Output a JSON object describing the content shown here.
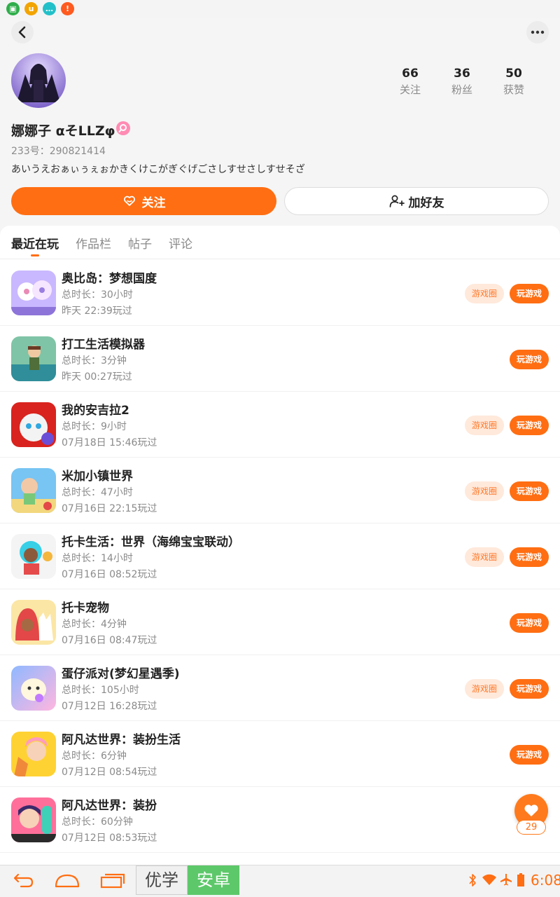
{
  "profile": {
    "name": "娜娜子 αそLLZφ",
    "id_line": "233号：290821414",
    "bio": "あいうえおぁぃぅぇぉかきくけこがぎぐげごさしすせさしすせそざ",
    "stats": [
      {
        "value": "66",
        "label": "关注"
      },
      {
        "value": "36",
        "label": "粉丝"
      },
      {
        "value": "50",
        "label": "获赞"
      }
    ]
  },
  "actions": {
    "follow_label": "关注",
    "add_friend_label": "加好友"
  },
  "tabs": [
    "最近在玩",
    "作品栏",
    "帖子",
    "评论"
  ],
  "active_tab": "最近在玩",
  "games": [
    {
      "name": "奥比岛：梦想国度",
      "duration": "总时长：30小时",
      "last": "昨天 22:39玩过",
      "circle": "游戏圈",
      "play": "玩游戏"
    },
    {
      "name": "打工生活模拟器",
      "duration": "总时长：3分钟",
      "last": "昨天 00:27玩过",
      "play": "玩游戏"
    },
    {
      "name": "我的安吉拉2",
      "duration": "总时长：9小时",
      "last": "07月18日 15:46玩过",
      "circle": "游戏圈",
      "play": "玩游戏"
    },
    {
      "name": "米加小镇世界",
      "duration": "总时长：47小时",
      "last": "07月16日 22:15玩过",
      "circle": "游戏圈",
      "play": "玩游戏"
    },
    {
      "name": "托卡生活：世界（海绵宝宝联动）",
      "duration": "总时长：14小时",
      "last": "07月16日 08:52玩过",
      "circle": "游戏圈",
      "play": "玩游戏"
    },
    {
      "name": "托卡宠物",
      "duration": "总时长：4分钟",
      "last": "07月16日 08:47玩过",
      "play": "玩游戏"
    },
    {
      "name": "蛋仔派对(梦幻星遇季)",
      "duration": "总时长：105小时",
      "last": "07月12日 16:28玩过",
      "circle": "游戏圈",
      "play": "玩游戏"
    },
    {
      "name": "阿凡达世界：装扮生活",
      "duration": "总时长：6分钟",
      "last": "07月12日 08:54玩过",
      "play": "玩游戏"
    },
    {
      "name": "阿凡达世界：装扮",
      "duration": "总时长：60分钟",
      "last": "07月12日 08:53玩过"
    }
  ],
  "like_count": "29",
  "bottom_bar": {
    "brand_a": "优学",
    "brand_b": "安卓",
    "time": "6:08"
  },
  "colors": {
    "accent": "#ff6e12",
    "accent_light": "#ffe9db",
    "text_primary": "#222222",
    "text_secondary": "#8a8a8a"
  }
}
